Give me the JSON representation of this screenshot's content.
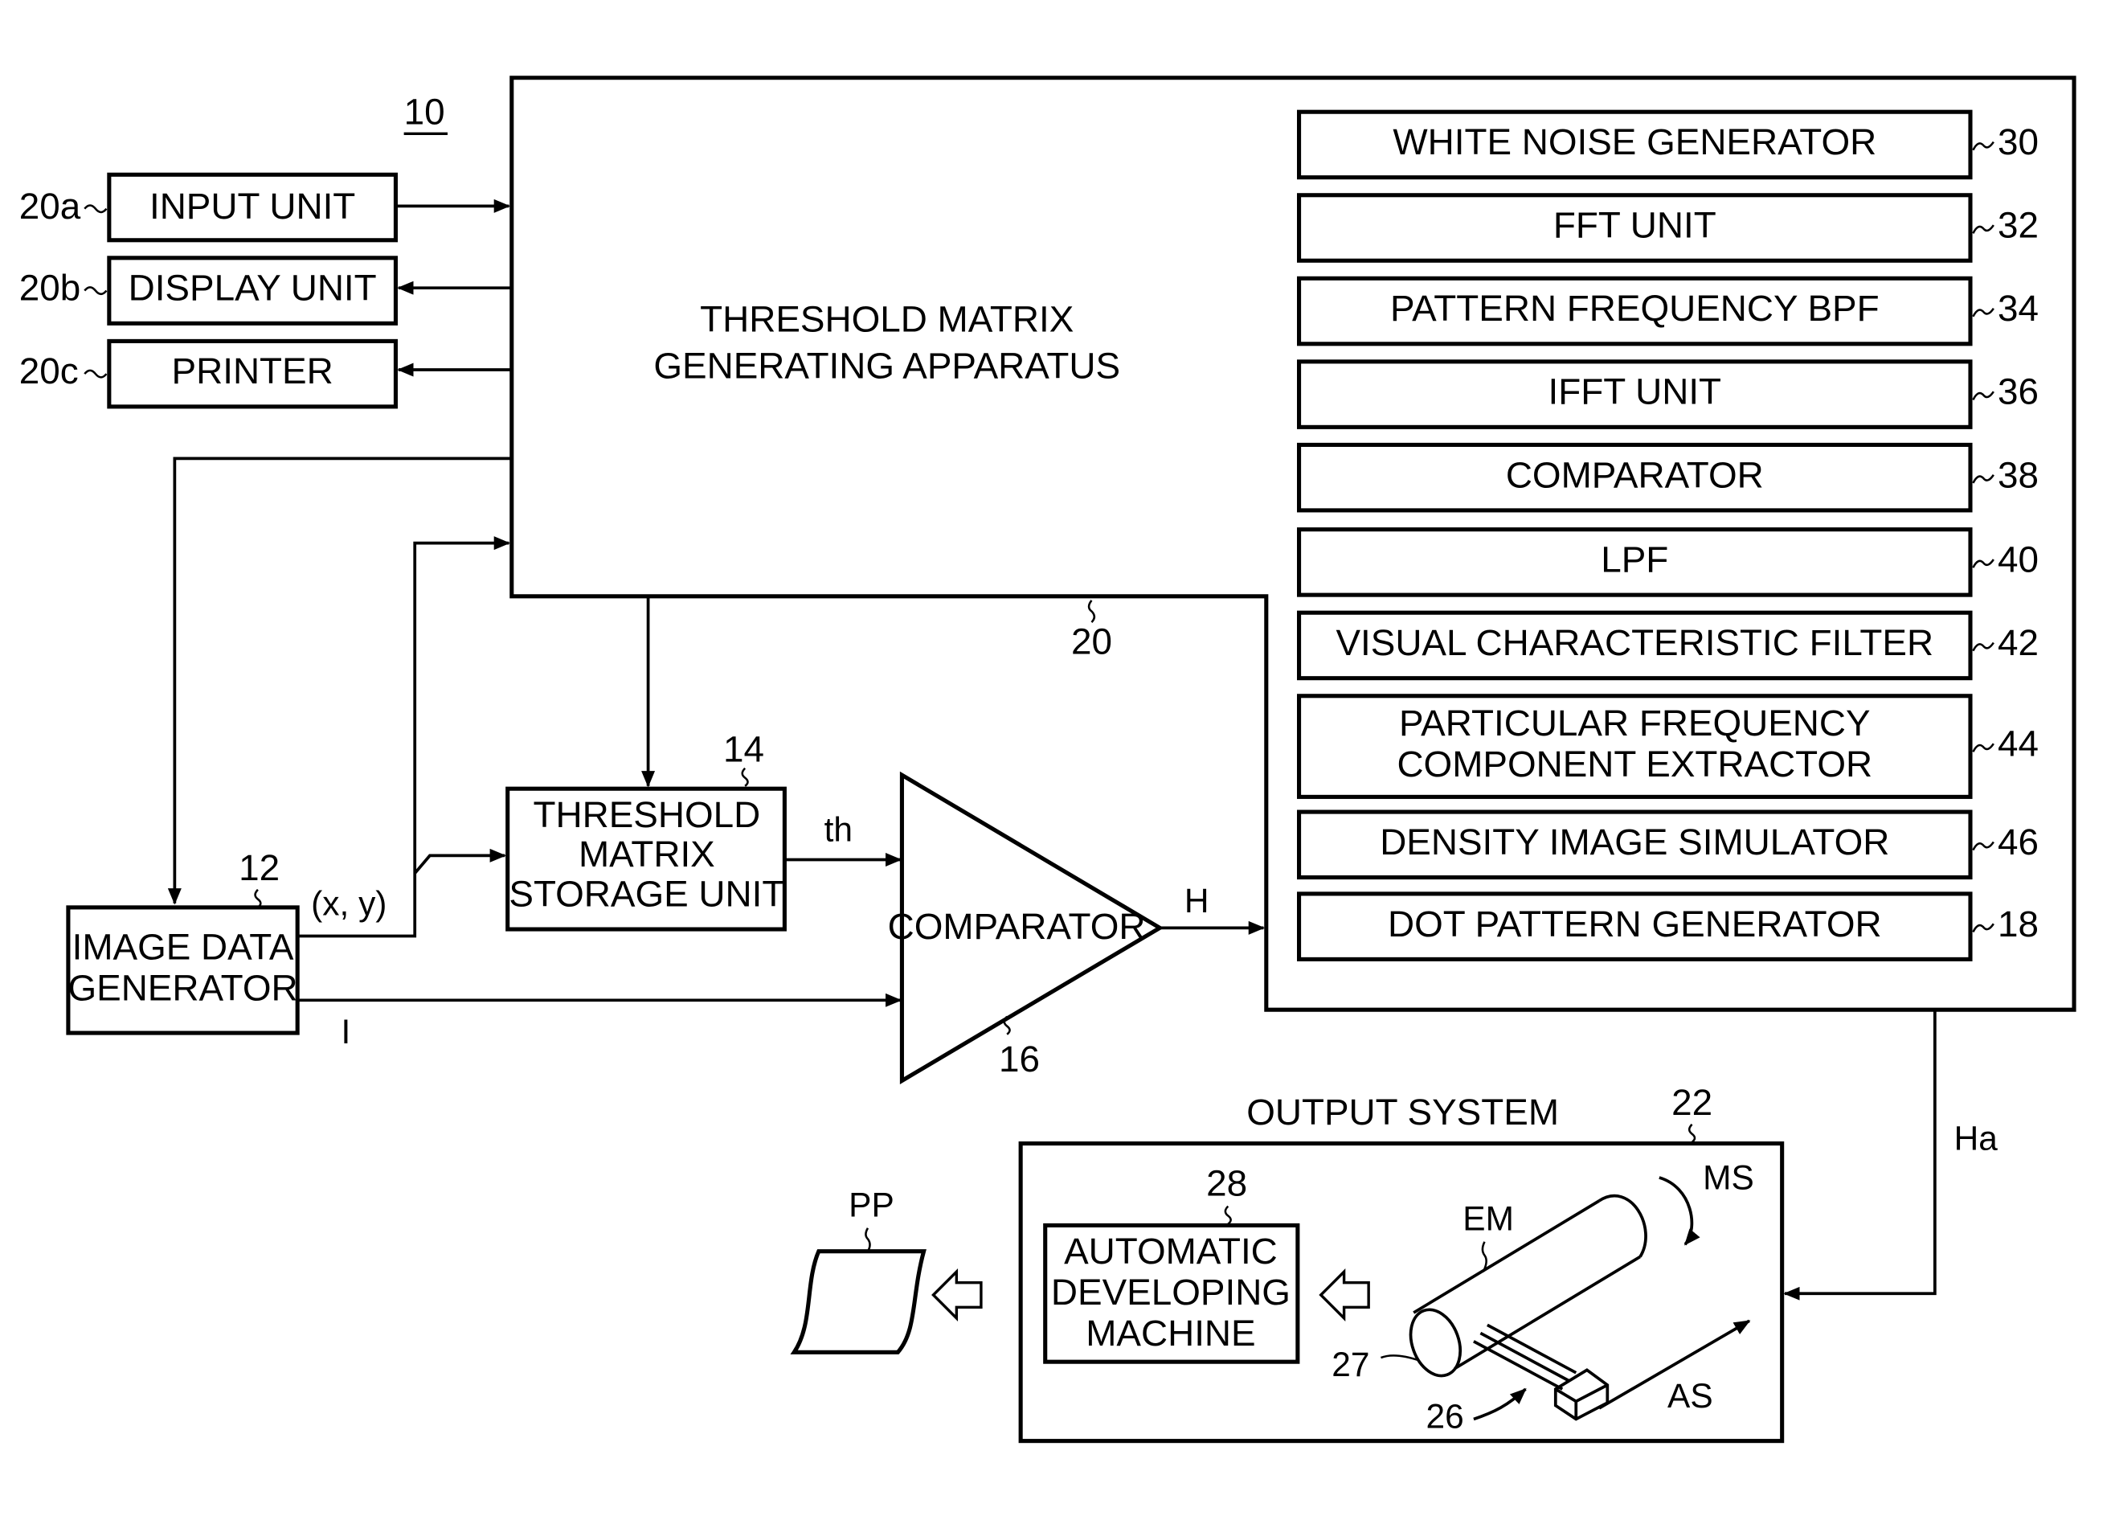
{
  "figure_ref": "10",
  "main_apparatus": {
    "title_line1": "THRESHOLD MATRIX",
    "title_line2": "GENERATING APPARATUS",
    "ref": "20"
  },
  "peripherals": [
    {
      "label": "INPUT UNIT",
      "ref": "20a",
      "direction": "to-apparatus"
    },
    {
      "label": "DISPLAY UNIT",
      "ref": "20b",
      "direction": "from-apparatus"
    },
    {
      "label": "PRINTER",
      "ref": "20c",
      "direction": "from-apparatus"
    }
  ],
  "modules": [
    {
      "label": "WHITE NOISE GENERATOR",
      "ref": "30"
    },
    {
      "label": "FFT UNIT",
      "ref": "32"
    },
    {
      "label": "PATTERN FREQUENCY BPF",
      "ref": "34"
    },
    {
      "label": "IFFT UNIT",
      "ref": "36"
    },
    {
      "label": "COMPARATOR",
      "ref": "38"
    },
    {
      "label": "LPF",
      "ref": "40"
    },
    {
      "label": "VISUAL CHARACTERISTIC FILTER",
      "ref": "42"
    },
    {
      "label_line1": "PARTICULAR FREQUENCY",
      "label_line2": "COMPONENT EXTRACTOR",
      "ref": "44"
    },
    {
      "label": "DENSITY IMAGE SIMULATOR",
      "ref": "46"
    },
    {
      "label": "DOT PATTERN GENERATOR",
      "ref": "18"
    }
  ],
  "image_data_generator": {
    "line1": "IMAGE DATA",
    "line2": "GENERATOR",
    "ref": "12"
  },
  "threshold_storage": {
    "line1": "THRESHOLD",
    "line2": "MATRIX",
    "line3": "STORAGE UNIT",
    "ref": "14"
  },
  "comparator": {
    "label": "COMPARATOR",
    "ref": "16"
  },
  "signals": {
    "xy": "(x, y)",
    "th": "th",
    "I": "I",
    "H": "H",
    "Ha": "Ha"
  },
  "output_system": {
    "title": "OUTPUT SYSTEM",
    "ref": "22",
    "developer": {
      "line1": "AUTOMATIC",
      "line2": "DEVELOPING",
      "line3": "MACHINE",
      "ref": "28"
    },
    "labels": {
      "EM": "EM",
      "MS": "MS",
      "AS": "AS",
      "drum_ref": "27",
      "head_ref": "26"
    },
    "print_label": "PP"
  }
}
